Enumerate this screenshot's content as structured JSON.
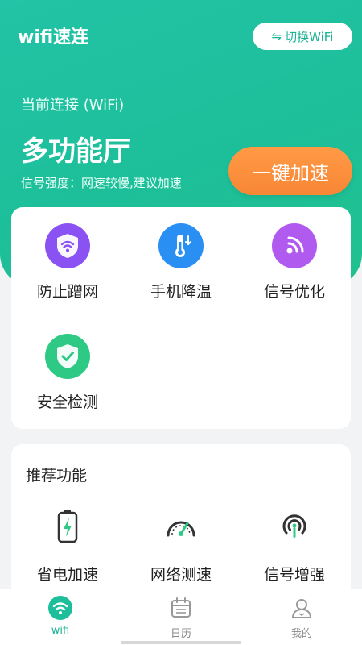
{
  "header": {
    "app_title": "wifi速连",
    "switch_label": "切换WiFi",
    "switch_icon": "swap-arrows-icon"
  },
  "connection": {
    "label": "当前连接 (WiFi)",
    "name": "多功能厅",
    "signal_text": "信号强度：网速较慢,建议加速",
    "boost_label": "一键加速"
  },
  "features": [
    {
      "label": "防止蹭网",
      "icon": "shield-wifi-icon",
      "color": "#8a52f2"
    },
    {
      "label": "手机降温",
      "icon": "thermometer-icon",
      "color": "#2a8ff2"
    },
    {
      "label": "信号优化",
      "icon": "signal-icon",
      "color": "#b15af0"
    },
    {
      "label": "安全检测",
      "icon": "shield-check-icon",
      "color": "#2ec985"
    }
  ],
  "recommended": {
    "title": "推荐功能",
    "items": [
      {
        "label": "省电加速",
        "icon": "battery-icon"
      },
      {
        "label": "网络测速",
        "icon": "speedometer-icon"
      },
      {
        "label": "信号增强",
        "icon": "signal-tower-icon"
      }
    ]
  },
  "tabbar": {
    "items": [
      {
        "label": "wifi",
        "icon": "wifi-icon",
        "active": true
      },
      {
        "label": "日历",
        "icon": "calendar-icon",
        "active": false
      },
      {
        "label": "我的",
        "icon": "profile-icon",
        "active": false
      }
    ]
  },
  "colors": {
    "primary": "#1dbf9a",
    "accent": "#f88635",
    "background": "#f2f3f5"
  }
}
